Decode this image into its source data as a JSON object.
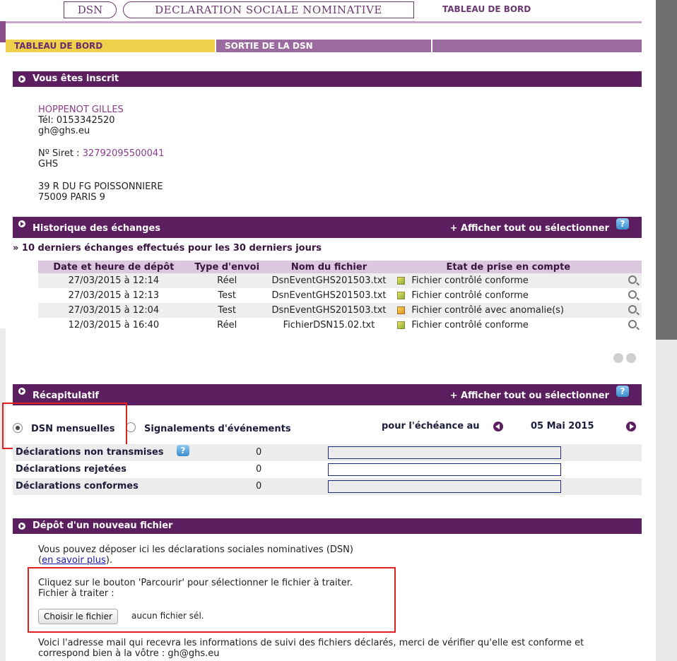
{
  "header": {
    "dsn_tab": "DSN",
    "title": "DECLARATION SOCIALE NOMINATIVE",
    "tableau_label": "TABLEAU DE BORD"
  },
  "nav": {
    "items": [
      "TABLEAU DE BORD",
      "SORTIE DE LA DSN"
    ]
  },
  "inscrit": {
    "title": "Vous êtes inscrit",
    "name": "HOPPENOT GILLES",
    "tel": "Tél: 0153342520",
    "email": "gh@ghs.eu",
    "siret_label": "Nº Siret : ",
    "siret_value": "32792095500041",
    "company": "GHS",
    "address1": "39   R   DU FG POISSONNIERE",
    "address2": "75009 PARIS 9"
  },
  "historique": {
    "title": "Historique des échanges",
    "action": "+ Afficher tout ou sélectionner",
    "help": "?",
    "subtitle": "» 10 derniers échanges effectués pour les 30 derniers jours",
    "columns": [
      "Date et heure de dépôt",
      "Type d'envoi",
      "Nom du fichier",
      "Etat de prise en compte"
    ],
    "rows": [
      {
        "date": "27/03/2015 à 12:14",
        "type": "Réel",
        "file": "DsnEventGHS201503.txt",
        "etat": "Fichier contrôlé conforme",
        "status": "ok"
      },
      {
        "date": "27/03/2015 à 12:13",
        "type": "Test",
        "file": "DsnEventGHS201503.txt",
        "etat": "Fichier contrôlé conforme",
        "status": "ok"
      },
      {
        "date": "27/03/2015 à 12:04",
        "type": "Test",
        "file": "DsnEventGHS201503.txt",
        "etat": "Fichier contrôlé avec anomalie(s)",
        "status": "warn"
      },
      {
        "date": "12/03/2015 à 16:40",
        "type": "Réel",
        "file": "FichierDSN15.02.txt",
        "etat": "Fichier contrôlé conforme",
        "status": "ok"
      }
    ]
  },
  "recap": {
    "title": "Récapitulatif",
    "action": "+ Afficher tout ou sélectionner",
    "help": "?",
    "radio_mensuelles": "DSN mensuelles",
    "radio_signalements": "Signalements d'événements",
    "echeance_label": "pour l'échéance au",
    "echeance_date": "05 Mai 2015",
    "rows": [
      {
        "label": "Déclarations non transmises",
        "value": "0",
        "progress": 0
      },
      {
        "label": "Déclarations rejetées",
        "value": "0",
        "progress": 0
      },
      {
        "label": "Déclarations conformes",
        "value": "0",
        "progress": 0
      }
    ]
  },
  "depot": {
    "title": "Dépôt d'un nouveau fichier",
    "intro": "Vous pouvez déposer ici les déclarations sociales nominatives (DSN)",
    "link_open": "(",
    "link_text": "en savoir plus",
    "link_close": ").",
    "instruction": "Cliquez sur le bouton 'Parcourir' pour sélectionner le fichier à traiter.",
    "file_label": "Fichier à traiter :",
    "choose_button": "Choisir le fichier",
    "no_file": "aucun fichier sél.",
    "mail_line1": "Voici l'adresse mail qui recevra les informations de suivi des fichiers déclarés, merci de vérifier qu'elle est conforme et",
    "mail_line2": "correspond bien à la vôtre : gh@ghs.eu"
  },
  "colors": {
    "purple_dark": "#5b1e5f",
    "purple_mid": "#9b6b9f",
    "yellow_active": "#f0d04a",
    "highlight_red": "#e02020"
  }
}
